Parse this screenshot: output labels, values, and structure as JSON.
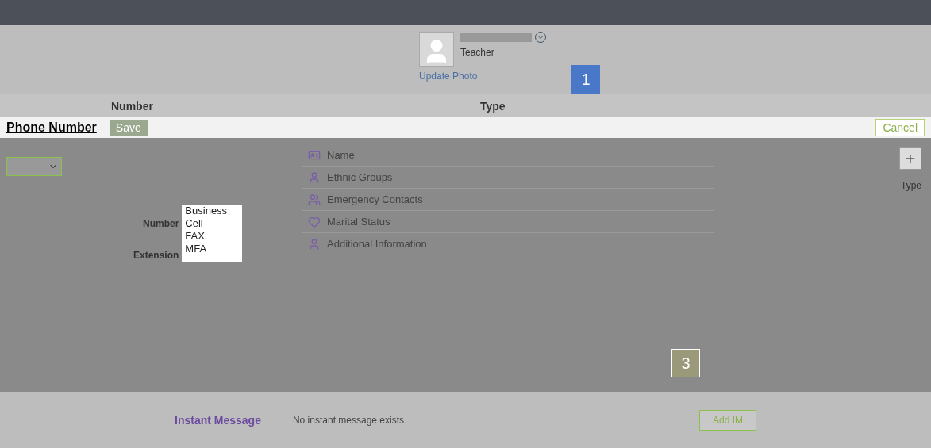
{
  "profile": {
    "role": "Teacher",
    "photo_link": "Update Photo"
  },
  "callouts": [
    "1",
    "3"
  ],
  "dialog": {
    "title": "Phone Number",
    "save": "Save",
    "cancel": "Cancel"
  },
  "columns": [
    "Number",
    "Type"
  ],
  "form": {
    "number_label": "Number",
    "extension_label": "Extension",
    "type_label": "Type",
    "type_options": [
      "Business",
      "Cell",
      "FAX",
      "MFA"
    ]
  },
  "menu": [
    {
      "label": "Name"
    },
    {
      "label": "Ethnic Groups"
    },
    {
      "label": "Emergency Contacts"
    },
    {
      "label": "Marital Status"
    },
    {
      "label": "Additional Information"
    }
  ],
  "instant_message": {
    "title": "Instant Message",
    "empty": "No instant message exists",
    "add": "Add IM"
  }
}
